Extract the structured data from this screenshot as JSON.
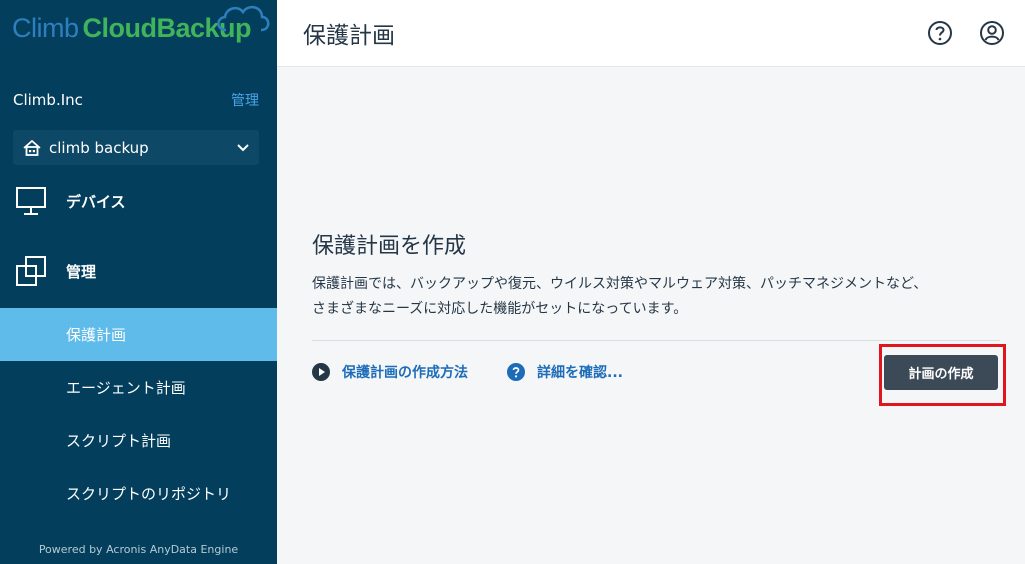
{
  "brand": {
    "part1": "Climb",
    "part2": "CloudBackup"
  },
  "sidebar": {
    "org_name": "Climb.Inc",
    "org_manage": "管理",
    "tenant": "climb backup",
    "main_items": [
      {
        "label": "デバイス",
        "icon": "monitor-icon"
      },
      {
        "label": "管理",
        "icon": "copy-windows-icon"
      }
    ],
    "sub_items": [
      {
        "label": "保護計画",
        "active": true
      },
      {
        "label": "エージェント計画",
        "active": false
      },
      {
        "label": "スクリプト計画",
        "active": false
      },
      {
        "label": "スクリプトのリポジトリ",
        "active": false
      }
    ],
    "powered_by": "Powered by Acronis AnyData Engine"
  },
  "header": {
    "title": "保護計画",
    "help_icon": "help-circle-icon",
    "user_icon": "user-circle-icon"
  },
  "main": {
    "title": "保護計画を作成",
    "description_line1": "保護計画では、バックアップや復元、ウイルス対策やマルウェア対策、パッチマネジメントなど、",
    "description_line2": "さまざまなニーズに対応した機能がセットになっています。",
    "link_howto": "保護計画の作成方法",
    "link_details": "詳細を確認...",
    "create_button": "計画の作成"
  },
  "colors": {
    "sidebar_bg": "#033f5c",
    "active_item": "#5ebbea",
    "accent_link": "#1c6cb8",
    "button_bg": "#3c4a58",
    "highlight": "#e0161e"
  }
}
